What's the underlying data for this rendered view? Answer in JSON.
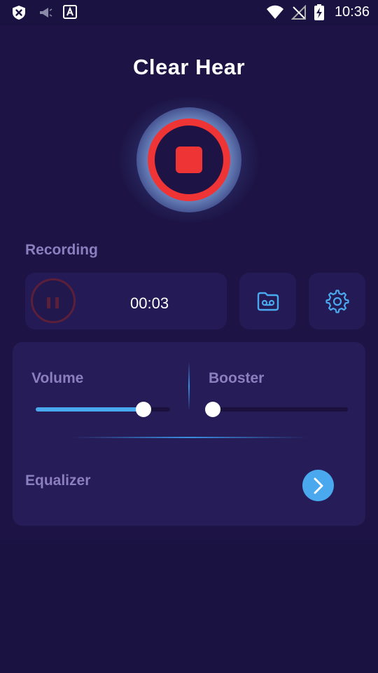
{
  "status_bar": {
    "time": "10:36",
    "left_icons": [
      "shield-x-icon",
      "megaphone-icon",
      "text-a-icon"
    ],
    "right_icons": [
      "wifi-icon",
      "no-signal-icon",
      "battery-charging-icon"
    ]
  },
  "app": {
    "title": "Clear Hear",
    "record_button": {
      "state": "recording",
      "icon": "stop-icon",
      "color": "#ef3436"
    }
  },
  "recording": {
    "label": "Recording",
    "timer": "00:03",
    "pause_icon": "pause-icon",
    "recordings_icon": "voicemail-folder-icon",
    "settings_icon": "gear-icon"
  },
  "controls": {
    "volume": {
      "label": "Volume",
      "level": 0.8
    },
    "booster": {
      "label": "Booster",
      "level": 0.0
    },
    "equalizer": {
      "label": "Equalizer",
      "icon": "chevron-right-icon"
    }
  },
  "colors": {
    "accent_blue": "#4aa8ee",
    "record_red": "#ef3436",
    "background": "#1d1445",
    "card": "#251c58",
    "label_purple": "#8c7fc0"
  }
}
